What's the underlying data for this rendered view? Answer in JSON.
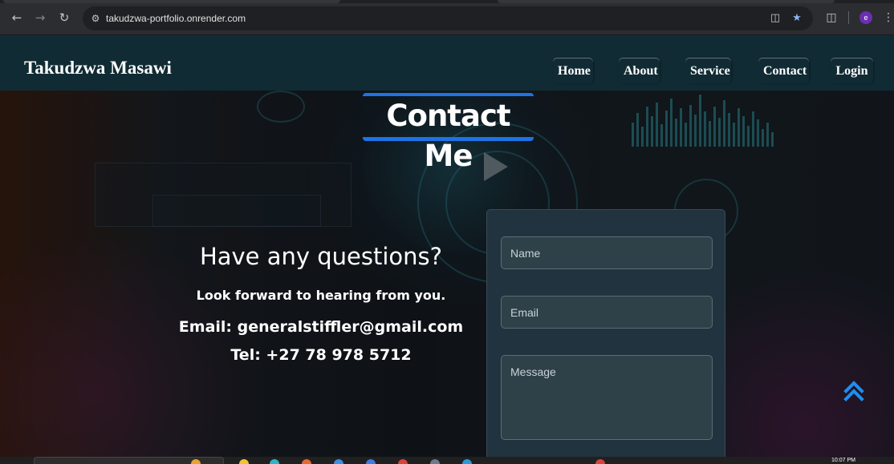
{
  "browser": {
    "url": "takudzwa-portfolio.onrender.com",
    "back_icon": "back-arrow-icon",
    "forward_icon": "forward-arrow-icon",
    "reload_icon": "reload-icon",
    "site_info_icon": "tune-icon",
    "install_icon": "install-app-icon",
    "bookmark_icon": "star-icon",
    "extensions_icon": "puzzle-icon",
    "profile_initial": "e",
    "menu_icon": "kebab-menu-icon"
  },
  "site": {
    "brand": "Takudzwa Masawi",
    "nav": [
      {
        "label": "Home"
      },
      {
        "label": "About"
      },
      {
        "label": "Service"
      },
      {
        "label": "Contact"
      },
      {
        "label": "Login"
      }
    ]
  },
  "contact": {
    "title": "Contact Me",
    "heading": "Have any questions?",
    "subheading": "Look forward to hearing from you.",
    "email": "Email: generalstiffler@gmail.com",
    "tel": "Tel: +27 78 978 5712",
    "form": {
      "name_placeholder": "Name",
      "email_placeholder": "Email",
      "message_placeholder": "Message"
    }
  },
  "scroll_top_icon": "double-chevron-up-icon",
  "taskbar": {
    "clock": "10:07 PM"
  },
  "colors": {
    "accent": "#1e73e6",
    "header_bg": "#112b34",
    "form_bg": "#223340"
  }
}
